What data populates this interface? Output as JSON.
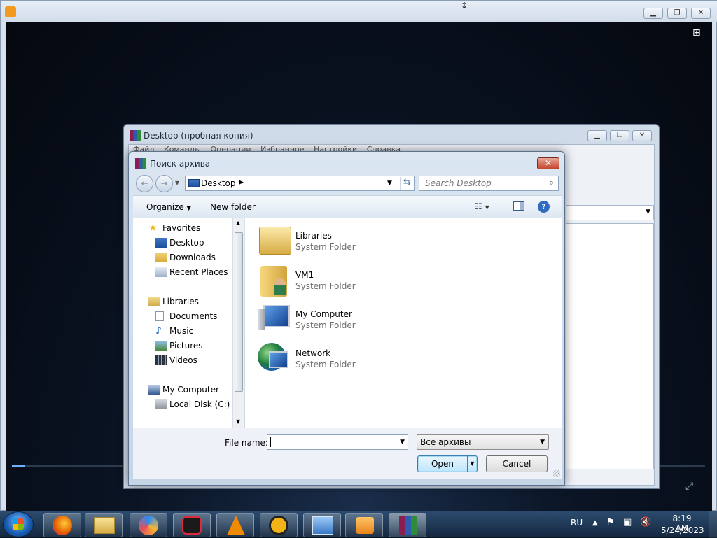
{
  "player": {
    "title": ""
  },
  "rar_window": {
    "title": "Desktop (пробная копия)",
    "menu": [
      "Файл",
      "Команды",
      "Операции",
      "Избранное",
      "Настройки",
      "Справка"
    ]
  },
  "dialog": {
    "title": "Поиск архива",
    "address": "Desktop",
    "search_placeholder": "Search Desktop",
    "toolbar": {
      "organize": "Organize",
      "new_folder": "New folder"
    },
    "nav": {
      "favorites": "Favorites",
      "desktop": "Desktop",
      "downloads": "Downloads",
      "recent_places": "Recent Places",
      "libraries": "Libraries",
      "documents": "Documents",
      "music": "Music",
      "pictures": "Pictures",
      "videos": "Videos",
      "my_computer": "My Computer",
      "local_disk": "Local Disk (C:)"
    },
    "items": [
      {
        "name": "Libraries",
        "type": "System Folder"
      },
      {
        "name": "VM1",
        "type": "System Folder"
      },
      {
        "name": "My Computer",
        "type": "System Folder"
      },
      {
        "name": "Network",
        "type": "System Folder"
      }
    ],
    "file_name_label": "File name:",
    "file_name_value": "",
    "filter": "Все архивы",
    "open": "Open",
    "cancel": "Cancel"
  },
  "taskbar": {
    "lang": "RU",
    "time": "8:19 AM",
    "date": "5/24/2023"
  }
}
